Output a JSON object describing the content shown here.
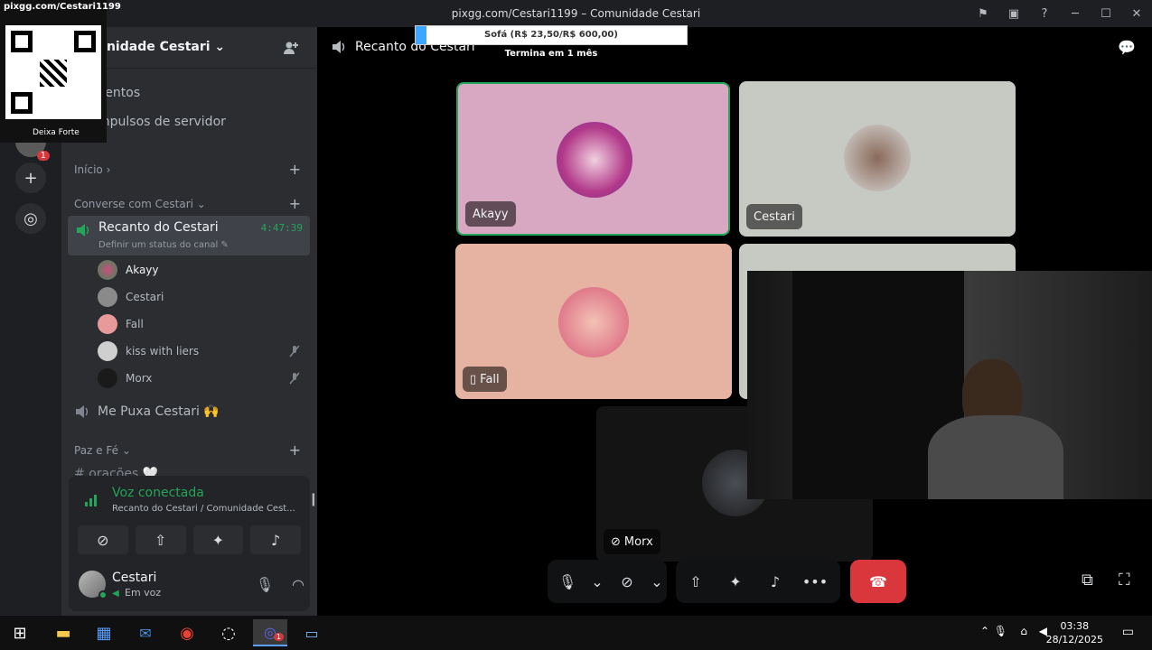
{
  "window": {
    "title": "pixgg.com/Cestari1199",
    "title_suffix": "Comunidade Cestari"
  },
  "server": {
    "name": "unidade Cestari",
    "links": [
      "ventos",
      "mpulsos de servidor"
    ]
  },
  "categories": {
    "inicio": "Início",
    "converse": "Converse com Cestari",
    "paz": "Paz e Fé"
  },
  "active_channel": {
    "name": "Recanto do Cestari",
    "status_hint": "Definir um status do canal",
    "timer": "4:47:39"
  },
  "members": [
    {
      "name": "Akayy",
      "muted": false
    },
    {
      "name": "Cestari",
      "muted": false
    },
    {
      "name": "Fall",
      "muted": false
    },
    {
      "name": "kiss with liers",
      "muted": true
    },
    {
      "name": "Morx",
      "muted": true
    }
  ],
  "other_channel": {
    "name": "Me Puxa Cestari 🙌"
  },
  "hidden_channel": {
    "name": "orações 🤍"
  },
  "voice": {
    "status": "Voz conectada",
    "location": "Recanto do Cestari / Comunidade Cest..."
  },
  "user": {
    "name": "Cestari",
    "status": "Em voz"
  },
  "stage": {
    "channel_title": "Recanto do Cestari",
    "tiles": [
      {
        "name": "Akayy",
        "bg": "#d8a8c3",
        "speaking": true
      },
      {
        "name": "Cestari",
        "bg": "#c7c9c3"
      },
      {
        "name": "Fall",
        "bg": "#e6b3a3",
        "mobile": true
      },
      {
        "name": "Morx",
        "bg": "#141414",
        "muted": true
      }
    ]
  },
  "overlays": {
    "qr_caption": "Deixa Forte",
    "qr_site": "pixgg.com/Cestari1199",
    "goal_text": "Sofá (R$ 23,50/R$ 600,00)",
    "goal_progress": 0.04,
    "goal_sub": "Termina em 1 mês",
    "guild_badge": "1"
  },
  "taskbar": {
    "time": "03:38",
    "date": "28/12/2025",
    "discord_badge": "1"
  },
  "colors": {
    "accent_green": "#23a55a",
    "danger": "#da373c",
    "blurple": "#5865f2"
  }
}
